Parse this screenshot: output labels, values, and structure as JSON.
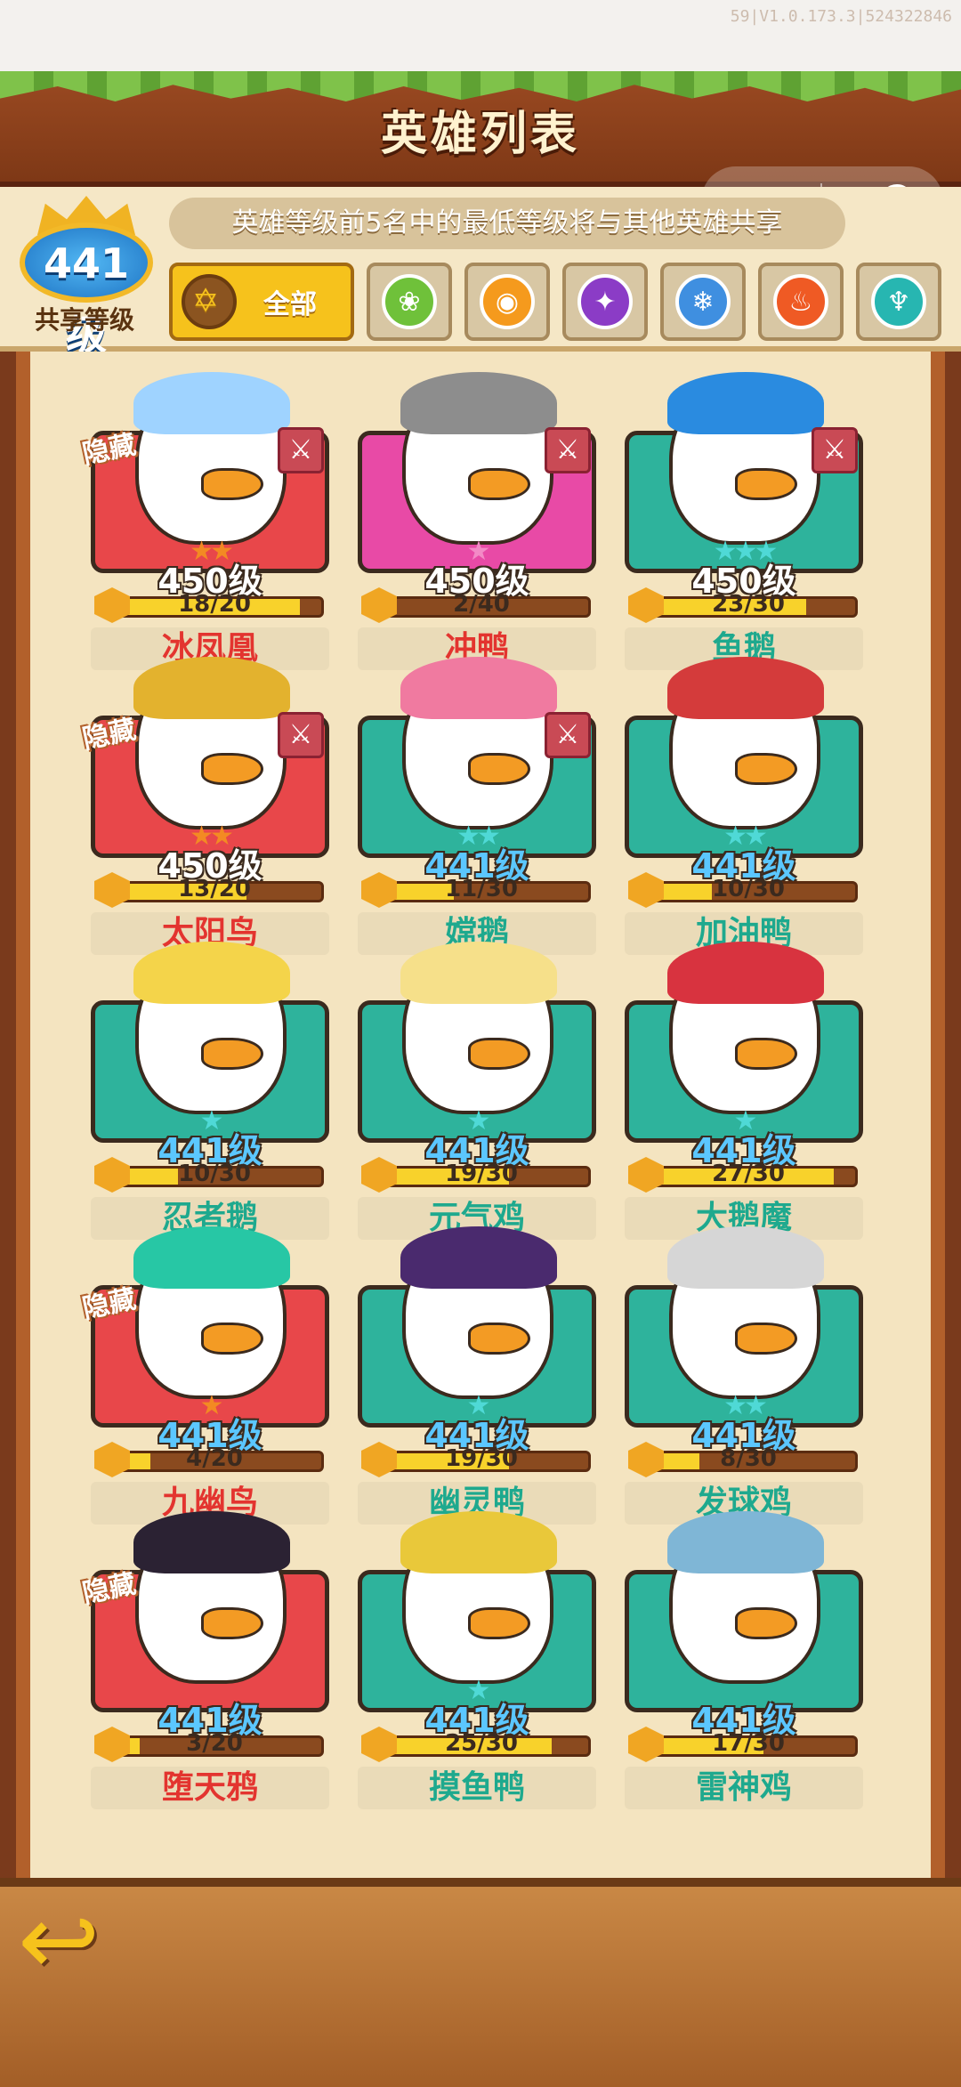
{
  "version": "59|V1.0.173.3|524322846",
  "header": {
    "title": "英雄列表"
  },
  "top_controls": {
    "more": "···"
  },
  "notice": "英雄等级前5名中的最低等级将与其他英雄共享",
  "shared_level": {
    "value": "441级",
    "label": "共享等级"
  },
  "filters": {
    "all_label": "全部",
    "elements": [
      {
        "name": "wind",
        "color": "#6fc13a",
        "glyph": "❀"
      },
      {
        "name": "light",
        "color": "#f59a1d",
        "glyph": "◉"
      },
      {
        "name": "dark",
        "color": "#8b3cc6",
        "glyph": "✦"
      },
      {
        "name": "ice",
        "color": "#3f8fe0",
        "glyph": "❄"
      },
      {
        "name": "fire",
        "color": "#ef5a24",
        "glyph": "♨"
      },
      {
        "name": "water",
        "color": "#27b6b1",
        "glyph": "♆"
      }
    ]
  },
  "heroes": [
    {
      "name": "冰凤凰",
      "level": "450级",
      "progress": "18/20",
      "ratio": 0.9,
      "hidden": true,
      "tag": "隐藏",
      "frame": "red",
      "stars": "★★",
      "star_color": "o"
    },
    {
      "name": "冲鸭",
      "level": "450级",
      "progress": "2/40",
      "ratio": 0.05,
      "hidden": false,
      "frame": "pink",
      "stars": "★",
      "star_color": "p"
    },
    {
      "name": "鱼鹅",
      "level": "450级",
      "progress": "23/30",
      "ratio": 0.77,
      "hidden": false,
      "frame": "teal",
      "stars": "★★★",
      "star_color": "c"
    },
    {
      "name": "太阳鸟",
      "level": "450级",
      "progress": "13/20",
      "ratio": 0.65,
      "hidden": true,
      "tag": "隐藏",
      "frame": "red",
      "stars": "★★",
      "star_color": "o"
    },
    {
      "name": "嫦鹅",
      "level": "441级",
      "progress": "11/30",
      "ratio": 0.37,
      "hidden": false,
      "frame": "teal",
      "stars": "★★",
      "star_color": "c"
    },
    {
      "name": "加油鸭",
      "level": "441级",
      "progress": "10/30",
      "ratio": 0.33,
      "hidden": false,
      "frame": "teal",
      "stars": "★★",
      "star_color": "c"
    },
    {
      "name": "忍者鹅",
      "level": "441级",
      "progress": "10/30",
      "ratio": 0.33,
      "hidden": false,
      "frame": "teal",
      "stars": "★",
      "star_color": "c"
    },
    {
      "name": "元气鸡",
      "level": "441级",
      "progress": "19/30",
      "ratio": 0.63,
      "hidden": false,
      "frame": "teal",
      "stars": "★",
      "star_color": "c"
    },
    {
      "name": "大鹅魔",
      "level": "441级",
      "progress": "27/30",
      "ratio": 0.9,
      "hidden": false,
      "frame": "teal",
      "stars": "★",
      "star_color": "c"
    },
    {
      "name": "九幽鸟",
      "level": "441级",
      "progress": "4/20",
      "ratio": 0.2,
      "hidden": true,
      "tag": "隐藏",
      "frame": "red",
      "stars": "★",
      "star_color": "o"
    },
    {
      "name": "幽灵鸭",
      "level": "441级",
      "progress": "19/30",
      "ratio": 0.63,
      "hidden": false,
      "frame": "teal",
      "stars": "★",
      "star_color": "c"
    },
    {
      "name": "发球鸡",
      "level": "441级",
      "progress": "8/30",
      "ratio": 0.27,
      "hidden": false,
      "frame": "teal",
      "stars": "★★",
      "star_color": "c"
    },
    {
      "name": "堕天鸦",
      "level": "441级",
      "progress": "3/20",
      "ratio": 0.15,
      "hidden": true,
      "tag": "隐藏",
      "frame": "red",
      "stars": "",
      "star_color": "o"
    },
    {
      "name": "摸鱼鸭",
      "level": "441级",
      "progress": "25/30",
      "ratio": 0.83,
      "hidden": false,
      "frame": "teal",
      "stars": "★",
      "star_color": "c"
    },
    {
      "name": "雷神鸡",
      "level": "441级",
      "progress": "17/30",
      "ratio": 0.57,
      "hidden": false,
      "frame": "teal",
      "stars": "",
      "star_color": "c"
    }
  ],
  "partial_row_tags": [
    "隐藏",
    "隐藏"
  ],
  "colors": {
    "wood": "#9b4a22",
    "parchment": "#f5e7c6",
    "gold": "#f6c21c"
  }
}
